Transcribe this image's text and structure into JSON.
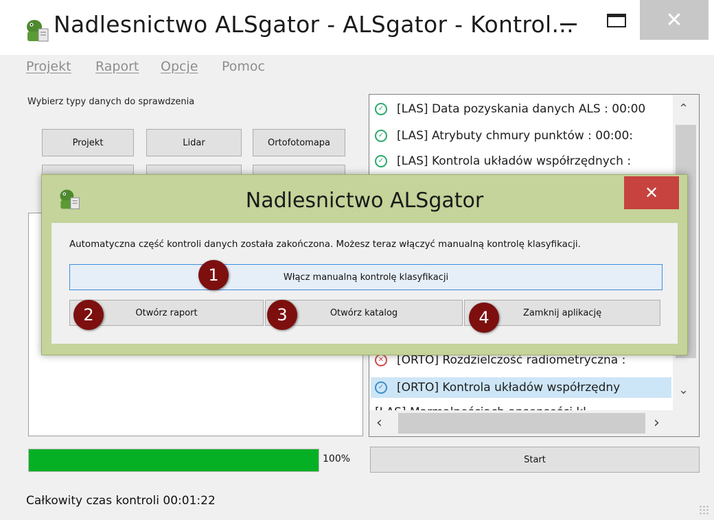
{
  "window": {
    "title": "Nadlesnictwo ALSgator - ALSgator - Kontrol...",
    "minimize_icon": "minimize-icon",
    "maximize_icon": "maximize-icon",
    "close_glyph": "✕"
  },
  "menu": {
    "items": [
      "Projekt",
      "Raport",
      "Opcje",
      "Pomoc"
    ]
  },
  "left_panel": {
    "label": "Wybierz typy danych do sprawdzenia",
    "buttons": [
      "Projekt",
      "Lidar",
      "Ortofotomapa"
    ]
  },
  "log": {
    "items": [
      {
        "text": "[LAS] Data pozyskania danych ALS : 00:00",
        "status": "ok"
      },
      {
        "text": "[LAS] Atrybuty chmury punktów : 00:00:",
        "status": "ok"
      },
      {
        "text": "[LAS] Kontrola układów współrzędnych :",
        "status": "ok"
      },
      {
        "text": "[ORTO] Rozdzielczość radiometryczna :",
        "status": "error"
      },
      {
        "text": "[ORTO] Kontrola układów współrzędny",
        "status": "selected"
      }
    ],
    "cut_item": "[LAS] Marmalnościach ansensości kl..."
  },
  "progress": {
    "value": 1.0,
    "label": "100%",
    "color": "#06b025"
  },
  "start_button": "Start",
  "status": {
    "text": "Całkowity czas kontroli 00:01:22"
  },
  "dialog": {
    "title": "Nadlesnictwo ALSgator",
    "close_glyph": "✕",
    "message": "Automatyczna część kontroli danych została zakończona. Możesz teraz włączyć manualną kontrolę klasyfikacji.",
    "buttons": {
      "manual": "Włącz manualną kontrolę klasyfikacji",
      "report": "Otwórz raport",
      "folder": "Otwórz katalog",
      "close_app": "Zamknij aplikację"
    },
    "badges": [
      "1",
      "2",
      "3",
      "4"
    ],
    "badge_color": "#7d0f0f"
  }
}
